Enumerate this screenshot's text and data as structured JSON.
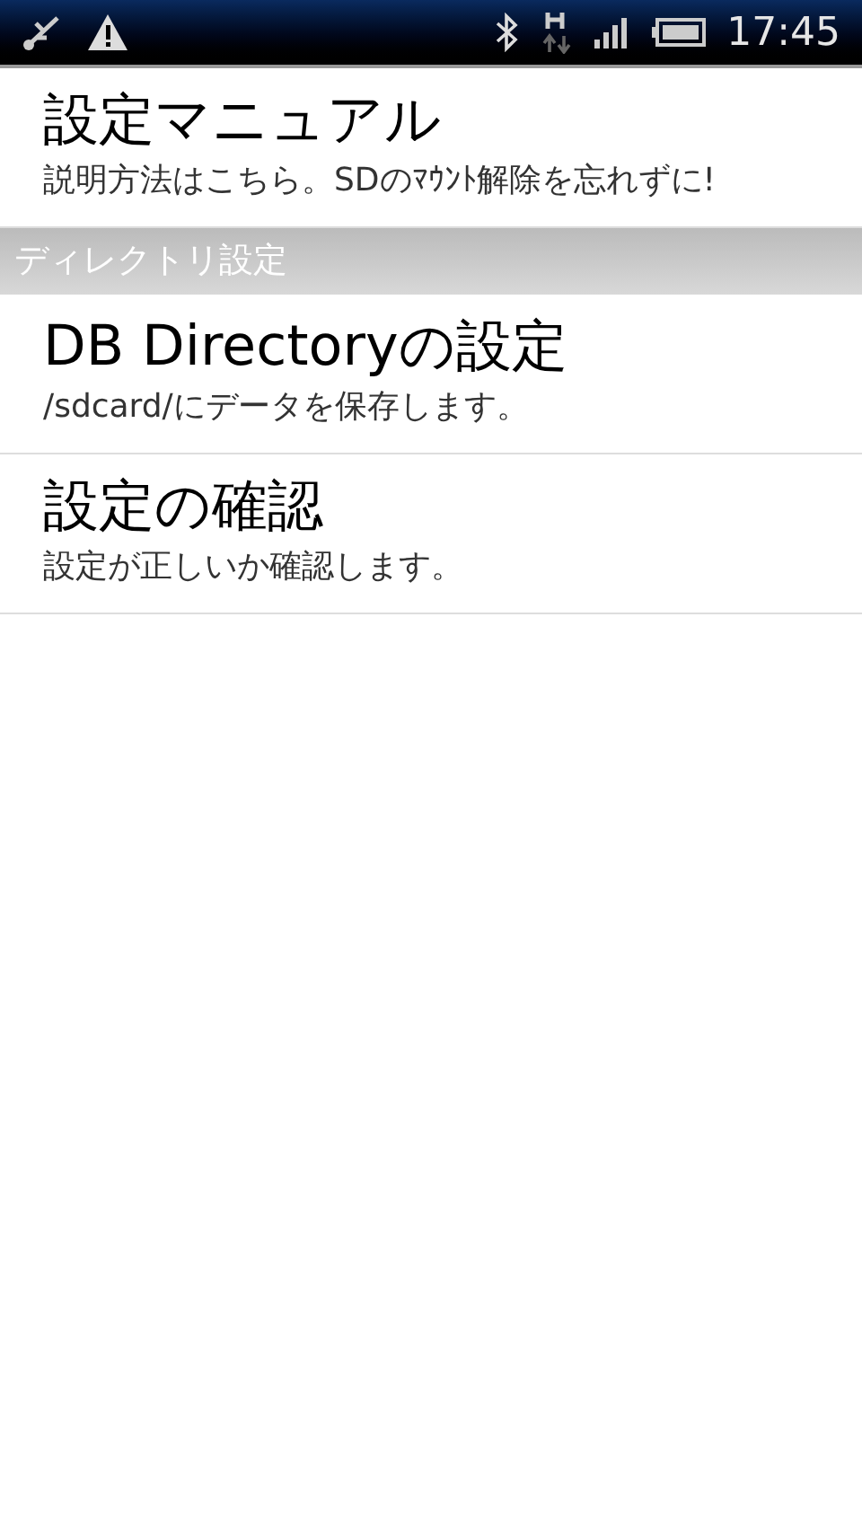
{
  "status_bar": {
    "time": "17:45"
  },
  "items": [
    {
      "kind": "item",
      "title": "設定マニュアル",
      "summary": "説明方法はこちら。SDのﾏｳﾝﾄ解除を忘れずに!"
    },
    {
      "kind": "header",
      "title": "ディレクトリ設定"
    },
    {
      "kind": "item",
      "title": "DB Directoryの設定",
      "summary": "/sdcard/にデータを保存します。"
    },
    {
      "kind": "item",
      "title": "設定の確認",
      "summary": "設定が正しいか確認します。"
    }
  ]
}
